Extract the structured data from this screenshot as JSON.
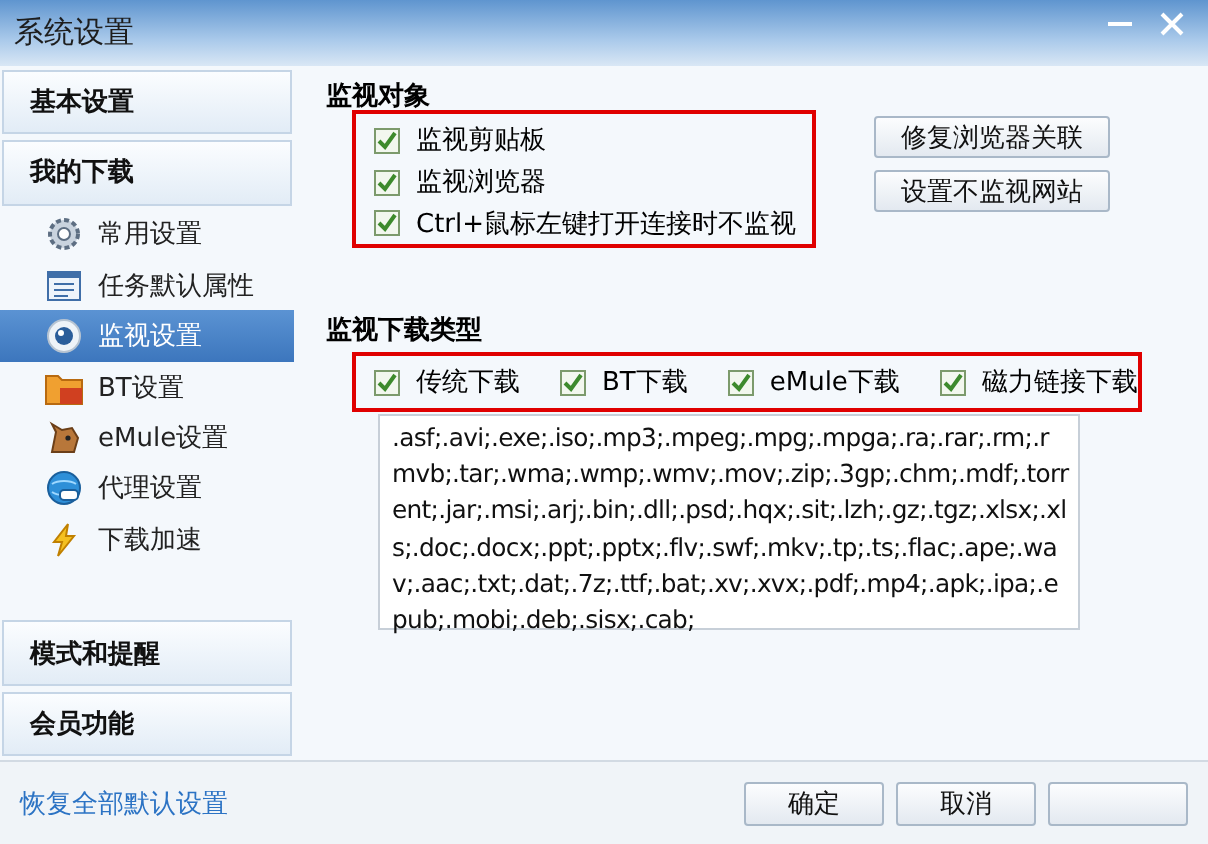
{
  "window": {
    "title": "系统设置"
  },
  "sidebar": {
    "items": [
      {
        "kind": "section",
        "label": "基本设置",
        "selected": false
      },
      {
        "kind": "section",
        "label": "我的下载",
        "selected": false
      },
      {
        "kind": "sub",
        "label": "常用设置",
        "selected": false
      },
      {
        "kind": "sub",
        "label": "任务默认属性",
        "selected": false
      },
      {
        "kind": "sub",
        "label": "监视设置",
        "selected": true
      },
      {
        "kind": "sub",
        "label": "BT设置",
        "selected": false
      },
      {
        "kind": "sub",
        "label": "eMule设置",
        "selected": false
      },
      {
        "kind": "sub",
        "label": "代理设置",
        "selected": false
      },
      {
        "kind": "sub",
        "label": "下载加速",
        "selected": false
      },
      {
        "kind": "spacer"
      },
      {
        "kind": "section",
        "label": "模式和提醒",
        "selected": false
      },
      {
        "kind": "section",
        "label": "会员功能",
        "selected": false
      }
    ]
  },
  "monitor_targets": {
    "heading": "监视对象",
    "options": [
      {
        "label": "监视剪贴板",
        "checked": true
      },
      {
        "label": "监视浏览器",
        "checked": true
      },
      {
        "label": "Ctrl+鼠标左键打开连接时不监视",
        "checked": true
      }
    ],
    "buttons": [
      "修复浏览器关联",
      "设置不监视网站"
    ]
  },
  "monitor_types": {
    "heading": "监视下载类型",
    "options": [
      {
        "label": "传统下载",
        "checked": true
      },
      {
        "label": "BT下载",
        "checked": true
      },
      {
        "label": "eMule下载",
        "checked": true
      },
      {
        "label": "磁力链接下载",
        "checked": true
      }
    ],
    "extensions": ".asf;.avi;.exe;.iso;.mp3;.mpeg;.mpg;.mpga;.ra;.rar;.rm;.rmvb;.tar;.wma;.wmp;.wmv;.mov;.zip;.3gp;.chm;.mdf;.torrent;.jar;.msi;.arj;.bin;.dll;.psd;.hqx;.sit;.lzh;.gz;.tgz;.xlsx;.xls;.doc;.docx;.ppt;.pptx;.flv;.swf;.mkv;.tp;.ts;.flac;.ape;.wav;.aac;.txt;.dat;.7z;.ttf;.bat;.xv;.xvx;.pdf;.mp4;.apk;.ipa;.epub;.mobi;.deb;.sisx;.cab;"
  },
  "footer": {
    "restore_link": "恢复全部默认设置",
    "buttons": [
      "确定",
      "取消"
    ]
  }
}
